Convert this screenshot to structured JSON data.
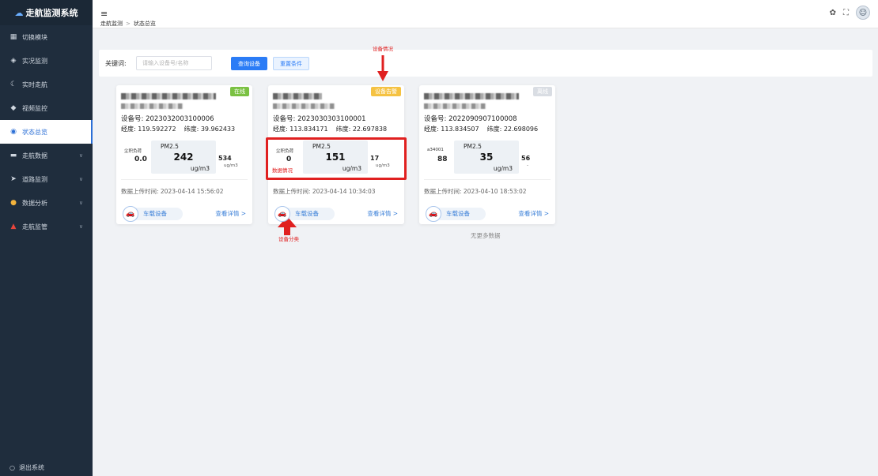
{
  "app": {
    "title": "走航监测系统"
  },
  "sidebar": {
    "items": [
      {
        "label": "切换模块",
        "icon": "grid-icon"
      },
      {
        "label": "实况监测",
        "icon": "eye-icon"
      },
      {
        "label": "实时走航",
        "icon": "moon-icon"
      },
      {
        "label": "视频监控",
        "icon": "camera-icon"
      },
      {
        "label": "状态总览",
        "icon": "overview-icon",
        "active": true
      },
      {
        "label": "走航数据",
        "icon": "data-icon",
        "expandable": true
      },
      {
        "label": "道路监测",
        "icon": "road-icon",
        "expandable": true
      },
      {
        "label": "数据分析",
        "icon": "analysis-icon",
        "expandable": true
      },
      {
        "label": "走航监管",
        "icon": "warning-icon",
        "expandable": true
      }
    ],
    "logout": "退出系统"
  },
  "topbar": {
    "breadcrumb": [
      "走航监测",
      "状态总览"
    ]
  },
  "search": {
    "label": "关键词:",
    "placeholder": "请输入设备号/名称",
    "query_button": "查询设备",
    "reset_button": "重置条件"
  },
  "cards": [
    {
      "status": "在线",
      "status_color": "#7ac142",
      "device_no": "设备号: 2023032003100006",
      "lon": "经度: 119.592272",
      "lat": "纬度: 39.962433",
      "left_label": "尘积负荷",
      "left_value": "0.0",
      "center_label": "PM2.5",
      "center_value": "242",
      "center_unit": "ug/m3",
      "right_value": "534",
      "right_unit": "ug/m3",
      "upload_time": "数据上传时间: 2023-04-14 15:56:02",
      "car_label": "车载设备",
      "detail_link": "查看详情 >"
    },
    {
      "status": "设备告警",
      "status_color": "#f5c242",
      "device_no": "设备号: 2023030303100001",
      "lon": "经度: 113.834171",
      "lat": "纬度: 22.697838",
      "left_label": "尘积负荷",
      "left_value": "0",
      "center_label": "PM2.5",
      "center_value": "151",
      "center_unit": "ug/m3",
      "right_value": "17",
      "right_unit": "ug/m3",
      "upload_time": "数据上传时间: 2023-04-14 10:34:03",
      "car_label": "车载设备",
      "detail_link": "查看详情 >"
    },
    {
      "status": "离线",
      "status_color": "#d9dde3",
      "device_no": "设备号: 2022090907100008",
      "lon": "经度: 113.834507",
      "lat": "纬度: 22.698096",
      "left_label": "a34001",
      "left_value": "88",
      "center_label": "PM2.5",
      "center_value": "35",
      "center_unit": "ug/m3",
      "right_value": "56",
      "right_unit": "-",
      "upload_time": "数据上传时间: 2023-04-10 18:53:02",
      "car_label": "车载设备",
      "detail_link": "查看详情 >"
    }
  ],
  "no_more": "无更多数据",
  "annotations": {
    "device_status": "设备情况",
    "data_status": "数据情况",
    "device_category": "设备分类"
  },
  "colors": {
    "accent": "#2b7cf6",
    "sidebar_bg": "#1f2d3d",
    "annotation": "#e02020"
  }
}
